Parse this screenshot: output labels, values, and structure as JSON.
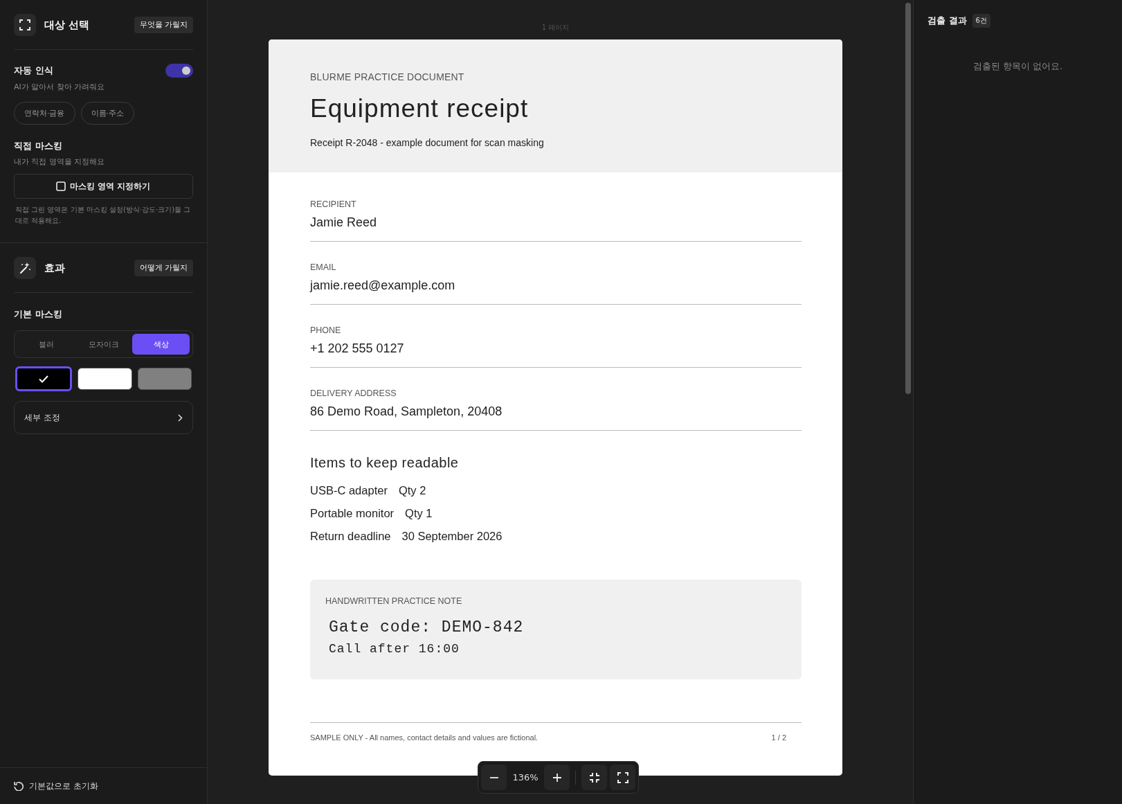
{
  "target_panel": {
    "title": "대상 선택",
    "help_button": "무엇을 가릴지",
    "auto_detect": {
      "label": "자동 인식",
      "description": "AI가 알아서 찾아 가려줘요",
      "on": true,
      "chips": [
        "연락처·금융",
        "이름·주소"
      ]
    },
    "manual_masking": {
      "label": "직접 마스킹",
      "description": "내가 직접 영역을 지정해요",
      "button": "마스킹 영역 지정하기",
      "note": "직접 그린 영역은 기본 마스킹 설정(방식·강도·크기)을 그대로 적용해요."
    }
  },
  "effect_panel": {
    "title": "효과",
    "help_button": "어떻게 가릴지",
    "basic_masking": {
      "label": "기본 마스킹",
      "modes": [
        {
          "label": "블러",
          "selected": false
        },
        {
          "label": "모자이크",
          "selected": false
        },
        {
          "label": "색상",
          "selected": true
        }
      ],
      "colors": [
        {
          "color": "#000000",
          "selected": true
        },
        {
          "color": "#ffffff",
          "selected": false
        },
        {
          "color": "#808080",
          "selected": false
        }
      ]
    },
    "details_row": "세부 조정"
  },
  "reset_button": "기본값으로 초기화",
  "viewer": {
    "page_label": "1 페이지",
    "document": {
      "eyebrow": "BLURME PRACTICE DOCUMENT",
      "title": "Equipment receipt",
      "subtitle": "Receipt R-2048 - example document for scan masking",
      "fields": [
        {
          "label": "RECIPIENT",
          "value": "Jamie Reed"
        },
        {
          "label": "EMAIL",
          "value": "jamie.reed@example.com"
        },
        {
          "label": "PHONE",
          "value": "+1 202 555 0127"
        },
        {
          "label": "DELIVERY ADDRESS",
          "value": "86 Demo Road, Sampleton, 20408"
        }
      ],
      "items_title": "Items to keep readable",
      "items": [
        {
          "name": "USB-C adapter",
          "value": "Qty 2"
        },
        {
          "name": "Portable monitor",
          "value": "Qty 1"
        },
        {
          "name": "Return deadline",
          "value": "30 September 2026"
        }
      ],
      "note": {
        "label": "HANDWRITTEN PRACTICE NOTE",
        "lines": [
          "Gate code: DEMO-842",
          "Call after 16:00"
        ]
      },
      "footer": {
        "text": "SAMPLE ONLY - All names, contact details and values are fictional.",
        "page": "1 / 2"
      }
    },
    "zoom": {
      "value": "136%"
    }
  },
  "results": {
    "title": "검출 결과",
    "count": "6건",
    "empty_message": "검출된 항목이 없어요."
  }
}
